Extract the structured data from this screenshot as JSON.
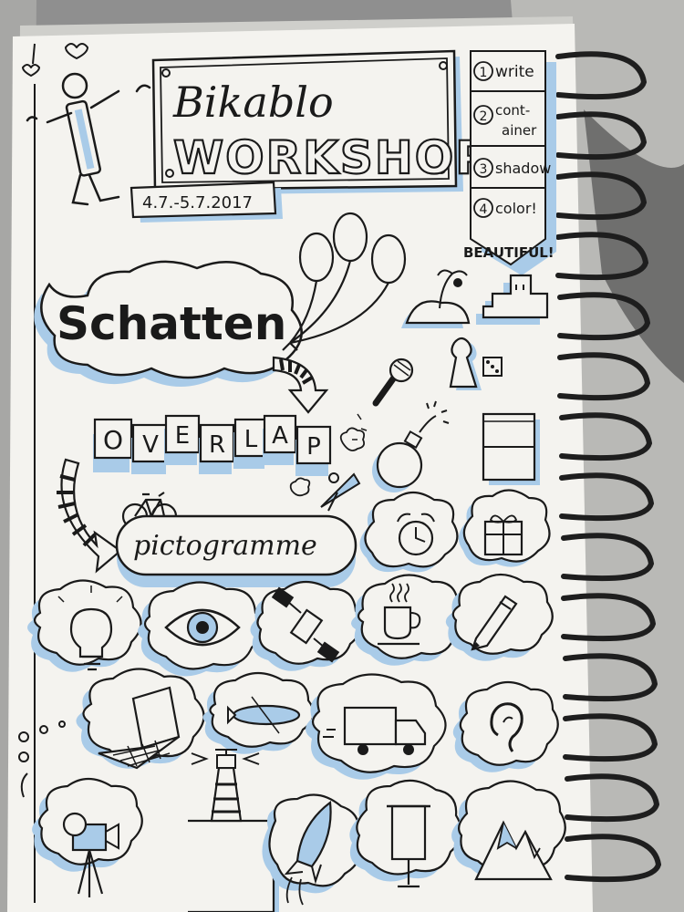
{
  "title": {
    "script": "Bikablo",
    "main": "WORKSHOP",
    "dates": "4.7.-5.7.2017"
  },
  "steps": [
    {
      "num": "1",
      "label": "write"
    },
    {
      "num": "2",
      "label": "cont-",
      "label2": "ainer"
    },
    {
      "num": "3",
      "label": "shadow"
    },
    {
      "num": "4",
      "label": "color!"
    }
  ],
  "beautiful": "BEAUTIFUL!",
  "schatten": "Schatten",
  "overlap_letters": [
    "O",
    "V",
    "E",
    "R",
    "L",
    "A",
    "P"
  ],
  "pictogramme": "pictogramme",
  "pictograms": [
    "balloons-icon",
    "island-icon",
    "building-icon",
    "pawn-icon",
    "dice-icon",
    "microphone-icon",
    "bomb-icon",
    "flipchart-icon",
    "bicycle-icon",
    "satellite-dish-icon",
    "alarm-clock-icon",
    "gift-icon",
    "lightbulb-icon",
    "eye-icon",
    "satellite-icon",
    "coffee-cup-icon",
    "pencil-icon",
    "laptop-icon",
    "airship-icon",
    "truck-icon",
    "ear-icon",
    "video-camera-icon",
    "lighthouse-icon",
    "rocket-icon",
    "easel-icon",
    "mountain-icon"
  ],
  "colors": {
    "paper": "#f4f3ef",
    "ink": "#1a1a1a",
    "shadow_blue": "#a9cbe8",
    "spiral": "#1e1e1e",
    "background": "#9a9a9a"
  }
}
